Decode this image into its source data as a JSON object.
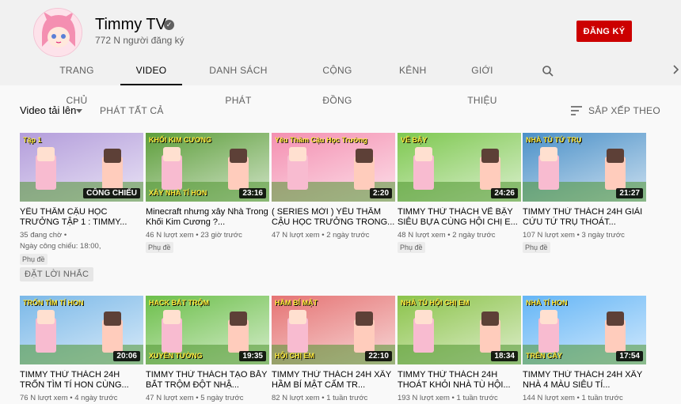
{
  "channel": {
    "name": "Timmy TV",
    "subscribers": "772 N người đăng ký",
    "subscribe_label": "ĐĂNG KÝ"
  },
  "tabs": [
    {
      "label": "TRANG CHỦ"
    },
    {
      "label": "VIDEO"
    },
    {
      "label": "DANH SÁCH PHÁT"
    },
    {
      "label": "CỘNG ĐỒNG"
    },
    {
      "label": "KÊNH"
    },
    {
      "label": "GIỚI THIỆU"
    }
  ],
  "filters": {
    "uploads_label": "Video tải lên",
    "play_all_label": "PHÁT TẤT CẢ",
    "sort_label": "SẮP XẾP THEO"
  },
  "videos": [
    {
      "title": "YÊU THẦM CẬU HỌC TRƯỞNG TẬP 1 : TIMMY...",
      "duration": "CÔNG CHIẾU",
      "meta": "35 đang chờ •",
      "meta2": "Ngày công chiếu: 18:00,",
      "badge": "Phụ đề",
      "remind": "ĐẶT LỜI NHẮC",
      "thumb_text": "Tập 1",
      "color": "#b39ddb"
    },
    {
      "title": "Minecraft nhưng xây Nhà Trong Khối Kim Cương ?...",
      "duration": "23:16",
      "meta": "46 N lượt xem • 23 giờ trước",
      "badge": "Phụ đề",
      "thumb_text": "KHỐI KIM CƯƠNG",
      "thumb_text2": "XÂY NHÀ TÍ HON",
      "color": "#5d9e3b"
    },
    {
      "title": "( SERIES MỚI ) YÊU THẦM CẬU HỌC TRƯỞNG TRONG...",
      "duration": "2:20",
      "meta": "47 N lượt xem • 2 ngày trước",
      "thumb_text": "Yêu Thầm Cậu Học Trưởng",
      "color": "#f48fb1"
    },
    {
      "title": "TIMMY THỬ THÁCH VẼ BẬY SIÊU BỰA CÙNG HỘI CHỊ E...",
      "duration": "24:26",
      "meta": "48 N lượt xem • 2 ngày trước",
      "badge": "Phụ đề",
      "thumb_text": "VẼ BẬY",
      "color": "#7ec850"
    },
    {
      "title": "TIMMY THỬ THÁCH 24H GIẢI CỨU TỨ TRỤ THOÁT...",
      "duration": "21:27",
      "meta": "107 N lượt xem • 3 ngày trước",
      "badge": "Phụ đề",
      "thumb_text": "NHÀ TÙ TỨ TRỤ",
      "color": "#4a90c8"
    },
    {
      "title": "TIMMY THỬ THÁCH 24H TRỐN TÌM TÍ HON CÙNG...",
      "duration": "20:06",
      "meta": "76 N lượt xem • 4 ngày trước",
      "thumb_text": "TRỐN TÌM TÍ HON",
      "color": "#7ab8e8"
    },
    {
      "title": "TIMMY THỬ THÁCH TẠO BẪY BẮT TRỘM ĐỘT NHẬ...",
      "duration": "19:35",
      "meta": "47 N lượt xem • 5 ngày trước",
      "thumb_text": "HACK BẮT TRỘM",
      "thumb_text2": "XUYÊN TƯỜNG",
      "color": "#6cbf4a"
    },
    {
      "title": "TIMMY THỬ THÁCH 24H XÂY HẦM BÍ MẬT CẤM TR...",
      "duration": "22:10",
      "meta": "82 N lượt xem • 1 tuần trước",
      "thumb_text": "HẦM BÍ MẬT",
      "thumb_text2": "HỘI CHỊ EM",
      "color": "#e57373"
    },
    {
      "title": "TIMMY THỬ THÁCH 24H THOÁT KHỎI NHÀ TÙ HỘI...",
      "duration": "18:34",
      "meta": "193 N lượt xem • 1 tuần trước",
      "thumb_text": "NHÀ TÙ HỘI CHỊ EM",
      "color": "#8bc34a"
    },
    {
      "title": "TIMMY THỬ THÁCH 24H XÂY NHÀ 4 MÀU SIÊU TÍ...",
      "duration": "17:54",
      "meta": "144 N lượt xem • 1 tuần trước",
      "thumb_text": "NHÀ TÍ HON",
      "thumb_text2": "TRÊN CÂY",
      "color": "#64b5f6"
    }
  ]
}
